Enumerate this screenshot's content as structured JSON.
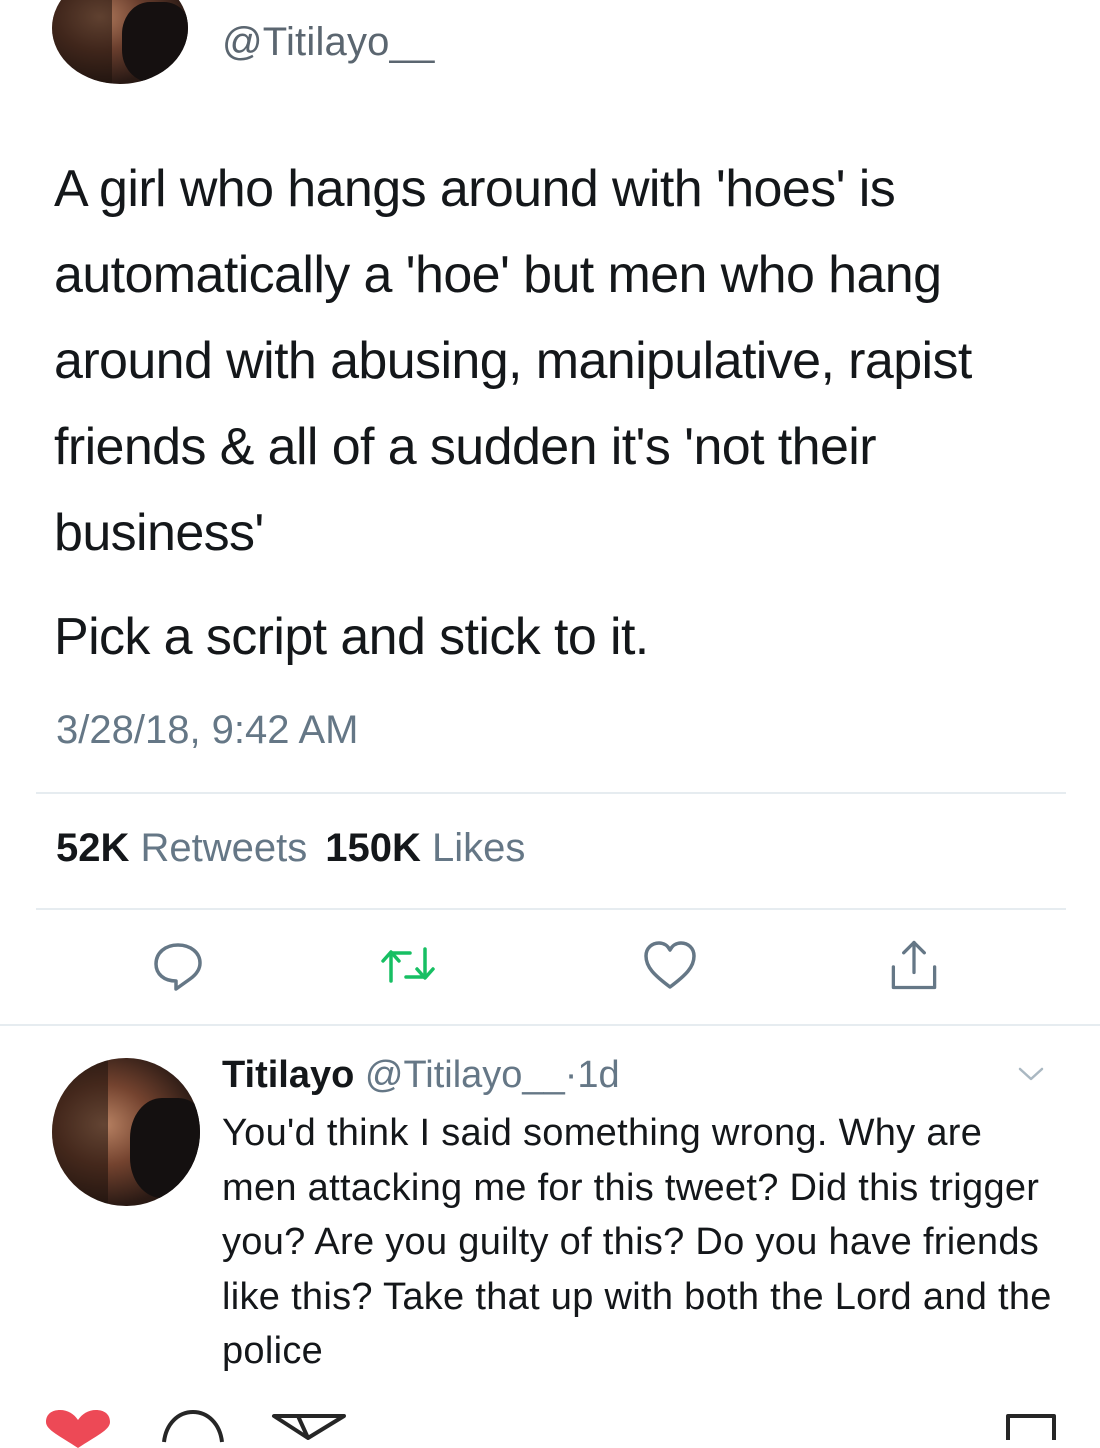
{
  "tweet": {
    "handle": "@Titilayo__",
    "text_para1": "A girl who hangs around with 'hoes' is automatically a 'hoe' but men who hang around with abusing, manipulative, rapist friends & all of a sudden it's 'not their business'",
    "text_para2": "Pick a script and stick to it.",
    "timestamp": "3/28/18, 9:42 AM",
    "retweets_count": "52K",
    "retweets_label": "Retweets",
    "likes_count": "150K",
    "likes_label": "Likes",
    "actions": [
      "reply-icon",
      "retweet-icon",
      "like-icon",
      "share-icon"
    ],
    "retweet_color": "#17bf63"
  },
  "reply": {
    "name": "Titilayo",
    "handle": "@Titilayo__",
    "separator": "·",
    "age": "1d",
    "text": "You'd think I said something wrong. Why are men attacking me for this tweet? Did this trigger you? Are you guilty of this? Do you have friends like this? Take that up with both the Lord and the police"
  },
  "bottom_bar": {
    "icons": [
      "heart-icon",
      "comment-icon",
      "send-icon",
      "bookmark-icon"
    ],
    "like_color": "#ed4956"
  }
}
